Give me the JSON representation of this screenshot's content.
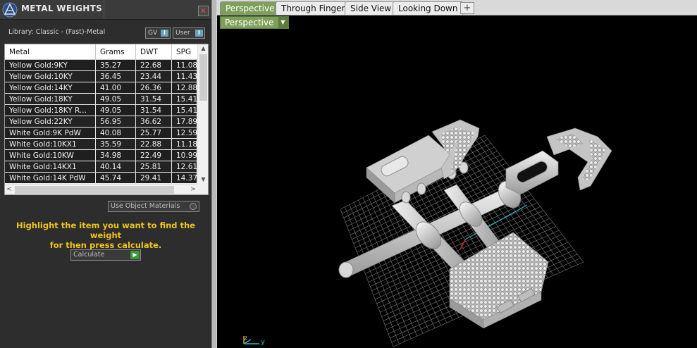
{
  "panel": {
    "title": "METAL WEIGHTS",
    "close_symbol": "✕",
    "library_label": "Library: Classic - (Fast)-Metal",
    "gv_label": "GV",
    "user_label": "User",
    "toggle_symbol": "I",
    "table": {
      "columns": [
        "Metal",
        "Grams",
        "DWT",
        "SPG"
      ],
      "rows": [
        [
          "Yellow Gold:9KY",
          "35.27",
          "22.68",
          "11.08"
        ],
        [
          "Yellow Gold:10KY",
          "36.45",
          "23.44",
          "11.43"
        ],
        [
          "Yellow Gold:14KY",
          "41.00",
          "26.36",
          "12.88"
        ],
        [
          "Yellow Gold:18KY",
          "49.05",
          "31.54",
          "15.41"
        ],
        [
          "Yellow Gold:18KY R...",
          "49.05",
          "31.54",
          "15.41"
        ],
        [
          "Yellow Gold:22KY",
          "56.95",
          "36.62",
          "17.89"
        ],
        [
          "White Gold:9K PdW",
          "40.08",
          "25.77",
          "12.59"
        ],
        [
          "White Gold:10KX1",
          "35.59",
          "22.88",
          "11.18"
        ],
        [
          "White Gold:10KW",
          "34.98",
          "22.49",
          "10.99"
        ],
        [
          "White Gold:14KX1",
          "40.14",
          "25.81",
          "12.61"
        ],
        [
          "White Gold:14K PdW",
          "45.74",
          "29.41",
          "14.37"
        ]
      ]
    },
    "use_object_materials": "Use Object Materials",
    "hint_line1": "Highlight the item you want to find the weight",
    "hint_line2": "for then press calculate.",
    "calculate_label": "Calculate",
    "calculate_symbol": "▶"
  },
  "viewport": {
    "tabs": [
      "Perspective",
      "Through Finger",
      "Side View",
      "Looking Down"
    ],
    "active_tab": "Perspective",
    "add_tab_symbol": "+",
    "view_dropdown": "Perspective",
    "caret_symbol": "▼",
    "axis_z": "z",
    "axis_y": "y"
  },
  "colors": {
    "accent_green": "#7fa05a",
    "hint_yellow": "#f0c419",
    "model_grey": "#c8c8c8",
    "grid_grey": "#7a7a7a",
    "axis_red": "#d02828",
    "axis_cyan": "#2ab8c8"
  },
  "icons": [
    "app-logo-icon",
    "close-icon",
    "radio-icon",
    "play-arrow-icon",
    "dropdown-caret-icon",
    "plus-icon",
    "axis-gizmo-icon"
  ]
}
